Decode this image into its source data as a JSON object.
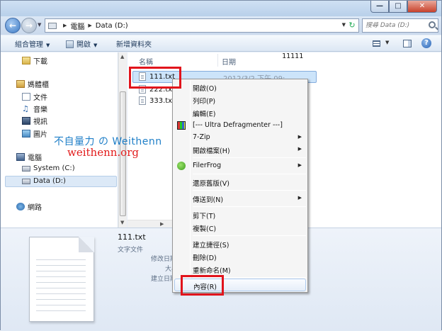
{
  "window": {
    "minimize": "—",
    "maximize": "□",
    "close": "✕"
  },
  "address": {
    "crumbs": [
      "電腦",
      "Data (D:)"
    ],
    "search_placeholder": "搜尋 Data (D:)"
  },
  "toolbar": {
    "organize": "組合管理",
    "open": "開啟",
    "new_folder": "新增資料夾"
  },
  "nav": {
    "downloads": "下載",
    "libraries": "媽體櫃",
    "documents": "文件",
    "music": "音樂",
    "videos": "視訊",
    "pictures": "圖片",
    "computer": "電腦",
    "system": "System (C:)",
    "data": "Data (D:)",
    "network": "網路"
  },
  "list": {
    "col_name": "名稱",
    "col_date": "日期",
    "files": [
      "111.txt",
      "222.txt",
      "333.txt"
    ],
    "selected_date": "2012/3/2 下午 09:",
    "preview": "11111"
  },
  "watermark": {
    "line1": "不自量力 の Weithenn",
    "line2": "weithenn.org"
  },
  "details": {
    "name": "111.txt",
    "type": "文字文件",
    "modified_label": "修改日期",
    "size_label": "大小",
    "created_label": "建立日期"
  },
  "menu": {
    "open": "開啟(O)",
    "print": "列印(P)",
    "edit": "編輯(E)",
    "defrag": "[--- Ultra Defragmenter ---]",
    "zip": "7-Zip",
    "open_with": "開啟檔案(H)",
    "filerfrog": "FilerFrog",
    "restore": "還原舊版(V)",
    "send_to": "傳送到(N)",
    "cut": "剪下(T)",
    "copy": "複製(C)",
    "shortcut": "建立捷徑(S)",
    "delete": "刪除(D)",
    "rename": "重新命名(M)",
    "properties": "內容(R)"
  }
}
